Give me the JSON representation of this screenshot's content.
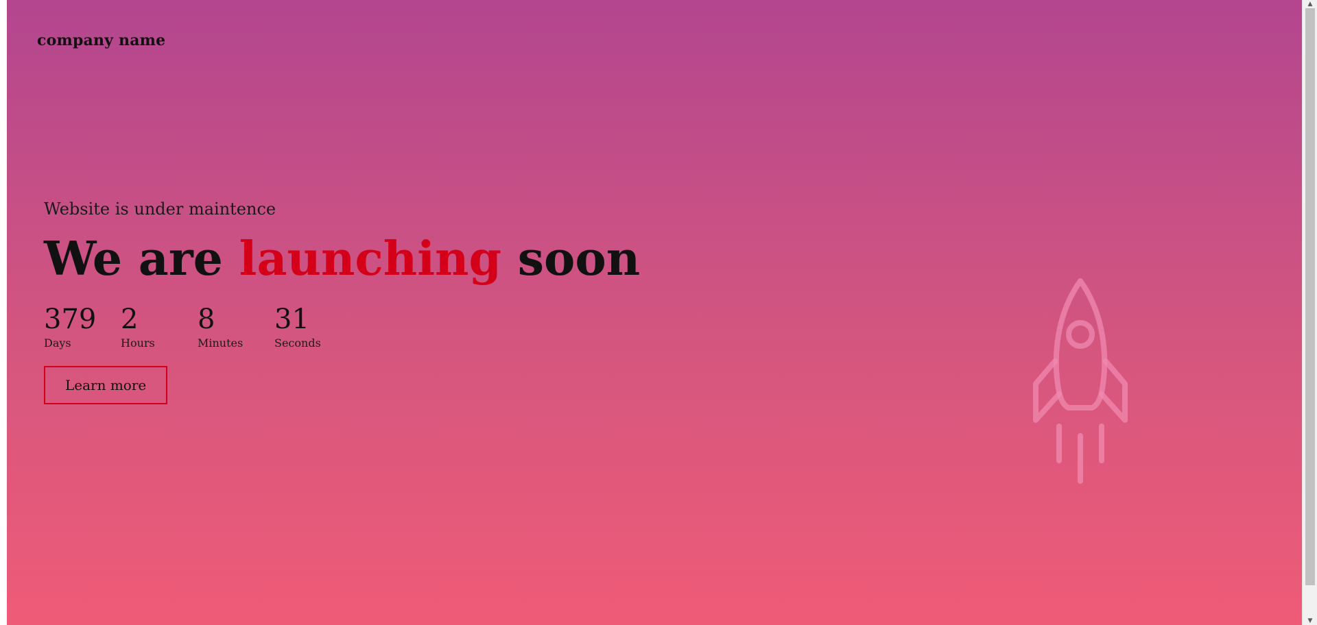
{
  "header": {
    "company_name": "company name"
  },
  "hero": {
    "subtitle": "Website is under maintence",
    "headline_part1": "We are",
    "headline_accent": "launching",
    "headline_part2": "soon"
  },
  "countdown": [
    {
      "value": "379",
      "label": "Days"
    },
    {
      "value": "2",
      "label": "Hours"
    },
    {
      "value": "8",
      "label": "Minutes"
    },
    {
      "value": "31",
      "label": "Seconds"
    }
  ],
  "cta": {
    "label": "Learn more"
  },
  "colors": {
    "gradient_top": "#b3468f",
    "gradient_bottom": "#ef5b77",
    "accent": "#d40019",
    "rocket_stroke": "#f08ab0"
  },
  "icons": {
    "rocket": "rocket-icon"
  }
}
